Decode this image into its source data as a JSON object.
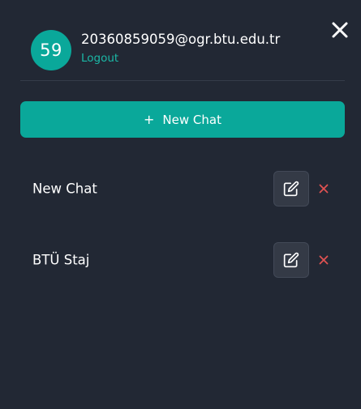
{
  "user": {
    "avatar_text": "59",
    "email": "20360859059@ogr.btu.edu.tr",
    "logout_label": "Logout"
  },
  "actions": {
    "new_chat_plus": "+",
    "new_chat_label": "New Chat"
  },
  "chats": [
    {
      "title": "New Chat"
    },
    {
      "title": "BTÜ Staj"
    }
  ],
  "colors": {
    "background": "#222834",
    "accent": "#0aa89a",
    "delete": "#e05252"
  },
  "icons": {
    "close": "close-icon",
    "edit": "edit-icon",
    "delete": "delete-icon"
  }
}
